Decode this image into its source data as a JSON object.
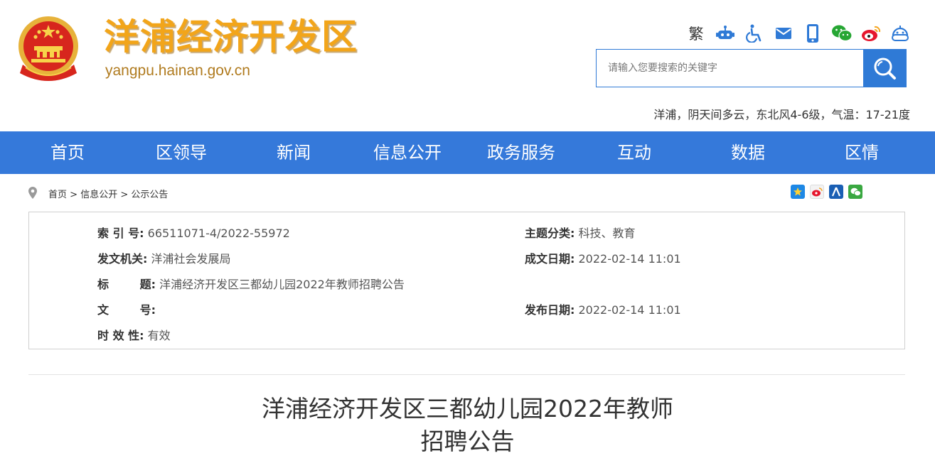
{
  "header": {
    "site_title": "洋浦经济开发区",
    "site_url": "yangpu.hainan.gov.cn",
    "traditional_label": "繁",
    "search_placeholder": "请输入您要搜索的关键字",
    "weather": "洋浦，阴天间多云，东北风4-6级，气温：17-21度"
  },
  "nav": {
    "items": [
      "首页",
      "区领导",
      "新闻",
      "信息公开",
      "政务服务",
      "互动",
      "数据",
      "区情"
    ]
  },
  "breadcrumb": {
    "items": [
      "首页",
      "信息公开",
      "公示公告"
    ],
    "separator": ">"
  },
  "meta": {
    "index_label": "索 引 号:",
    "index_value": "66511071-4/2022-55972",
    "category_label": "主题分类:",
    "category_value": "科技、教育",
    "issuer_label": "发文机关:",
    "issuer_value": "洋浦社会发展局",
    "created_label": "成文日期:",
    "created_value": "2022-02-14 11:01",
    "title_label_1": "标",
    "title_label_2": "题:",
    "title_value": "洋浦经济开发区三都幼儿园2022年教师招聘公告",
    "docno_label_1": "文",
    "docno_label_2": "号:",
    "docno_value": "",
    "published_label": "发布日期:",
    "published_value": "2022-02-14 11:01",
    "validity_label": "时 效 性:",
    "validity_value": "有效"
  },
  "article": {
    "title_line1": "洋浦经济开发区三都幼儿园2022年教师",
    "title_line2": "招聘公告"
  },
  "colors": {
    "nav_blue": "#3579da",
    "title_orange": "#f2a51a",
    "url_brown": "#b07b1f"
  }
}
